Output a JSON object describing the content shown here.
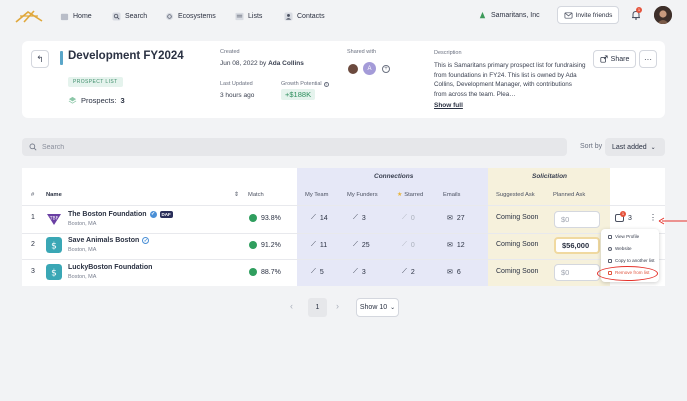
{
  "nav": {
    "items": [
      {
        "label": "Home",
        "icon": "home-icon"
      },
      {
        "label": "Search",
        "icon": "search-icon"
      },
      {
        "label": "Ecosystems",
        "icon": "ecosystems-icon"
      },
      {
        "label": "Lists",
        "icon": "lists-icon"
      },
      {
        "label": "Contacts",
        "icon": "contacts-icon"
      }
    ],
    "org_name": "Samaritans, Inc",
    "invite_label": "Invite friends",
    "notification_count": "1"
  },
  "list_header": {
    "title": "Development FY2024",
    "tag": "PROSPECT LIST",
    "prospects_label": "Prospects:",
    "prospects_count": "3",
    "created_label": "Created",
    "created_date": "Jun 08, 2022",
    "created_by_word": "by",
    "created_by": "Ada Collins",
    "updated_label": "Last Updated",
    "updated_value": "3 hours ago",
    "growth_label": "Growth Potential",
    "growth_value": "+$188K",
    "shared_label": "Shared with",
    "shared_avatar_initial": "A",
    "description_label": "Description",
    "description": "This is Samaritans primary prospect list for fundraising from foundations in FY24. This list is owned by Ada Collins, Development Manager, with contributions from across the team. Plea…",
    "show_full": "Show full",
    "share_label": "Share"
  },
  "search": {
    "placeholder": "Search",
    "sort_label": "Sort by",
    "sort_value": "Last added"
  },
  "table": {
    "group_connections": "Connections",
    "group_solicitation": "Solicitation",
    "columns": {
      "num": "#",
      "name": "Name",
      "match": "Match",
      "my_team": "My Team",
      "my_funders": "My Funders",
      "starred": "Starred",
      "emails": "Emails",
      "suggested_ask": "Suggested Ask",
      "planned_ask": "Planned Ask"
    },
    "rows": [
      {
        "num": "1",
        "name": "The Boston Foundation",
        "badge": "DAF",
        "location": "Boston, MA",
        "match": "93.8%",
        "my_team": "14",
        "my_funders": "3",
        "starred": "0",
        "emails": "27",
        "suggested_ask": "Coming Soon",
        "planned_ask": "$0",
        "comments": "3",
        "comment_badge": "1"
      },
      {
        "num": "2",
        "name": "Save Animals Boston",
        "badge": "",
        "location": "Boston, MA",
        "match": "91.2%",
        "my_team": "11",
        "my_funders": "25",
        "starred": "0",
        "emails": "12",
        "suggested_ask": "Coming Soon",
        "planned_ask": "$56,000",
        "comments": "",
        "comment_badge": ""
      },
      {
        "num": "3",
        "name": "LuckyBoston Foundation",
        "badge": "",
        "location": "Boston, MA",
        "match": "88.7%",
        "my_team": "5",
        "my_funders": "3",
        "starred": "2",
        "emails": "6",
        "suggested_ask": "Coming Soon",
        "planned_ask": "$0",
        "comments": "",
        "comment_badge": ""
      }
    ]
  },
  "context_menu": {
    "items": [
      "View Profile",
      "Website",
      "Copy to another list",
      "Remove from list"
    ]
  },
  "pagination": {
    "page": "1",
    "page_size": "Show 10"
  },
  "colors": {
    "accent": "#5aa6c9",
    "connections_band": "#e6e8f7",
    "solicitation_band": "#f6f1dc",
    "success": "#2f9e5e",
    "danger": "#e5322b"
  }
}
